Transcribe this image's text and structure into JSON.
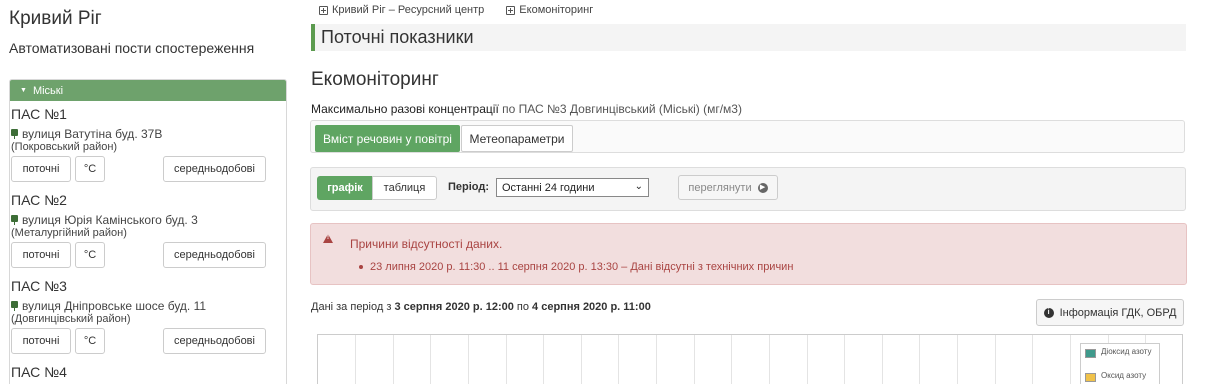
{
  "sidebar": {
    "city": "Кривий Ріг",
    "subtitle": "Автоматизовані пости спостереження",
    "group_label": "Міські",
    "stations": [
      {
        "name": "ПАС №1",
        "address": "вулиця Ватутіна буд. 37В",
        "district": "(Покровський район)"
      },
      {
        "name": "ПАС №2",
        "address": "вулиця Юрія Камінського буд. 3",
        "district": "(Металургійний район)"
      },
      {
        "name": "ПАС №3",
        "address": "вулиця Дніпровське шосе буд. 11",
        "district": "(Довгинцівський район)"
      },
      {
        "name": "ПАС №4"
      }
    ],
    "btn_current": "поточні",
    "btn_temp": "°C",
    "btn_daily": "середньодобові"
  },
  "breadcrumbs": [
    "Кривий Ріг – Ресурсний центр",
    "Екомоніторинг"
  ],
  "section_title": "Поточні показники",
  "heading": "Екомоніторинг",
  "concentration": {
    "label": "Максимально разові концентрації",
    "detail": "по ПАС №3 Довгинцівський (Міські) (мг/м3)"
  },
  "tabs": {
    "active": "Вміст речовин у повітрі",
    "inactive": "Метеопараметри"
  },
  "controls": {
    "graph": "графік",
    "table": "таблиця",
    "period_label": "Період:",
    "period_value": "Останні 24 години",
    "view_button": "переглянути"
  },
  "alert": {
    "title": "Причини відсутності даних.",
    "items": [
      "23 липня 2020 р. 11:30 .. 11 серпня 2020 р. 13:30 – Дані відсутні з технічних причин"
    ]
  },
  "period_info": {
    "prefix": "Дані за період з",
    "from": "3 серпня 2020 р. 12:00",
    "middle": "по",
    "to": "4 серпня 2020 р. 11:00"
  },
  "info_button": "Інформація ГДК, ОБРД",
  "chart_legend": [
    {
      "label": "Діоксид азоту",
      "color": "#3f9a8c"
    },
    {
      "label": "Оксид азоту",
      "color": "#f0c24a"
    }
  ],
  "colors": {
    "accent_green": "#5fa562",
    "alert_red": "#a94442",
    "alert_bg": "#f2dede"
  }
}
